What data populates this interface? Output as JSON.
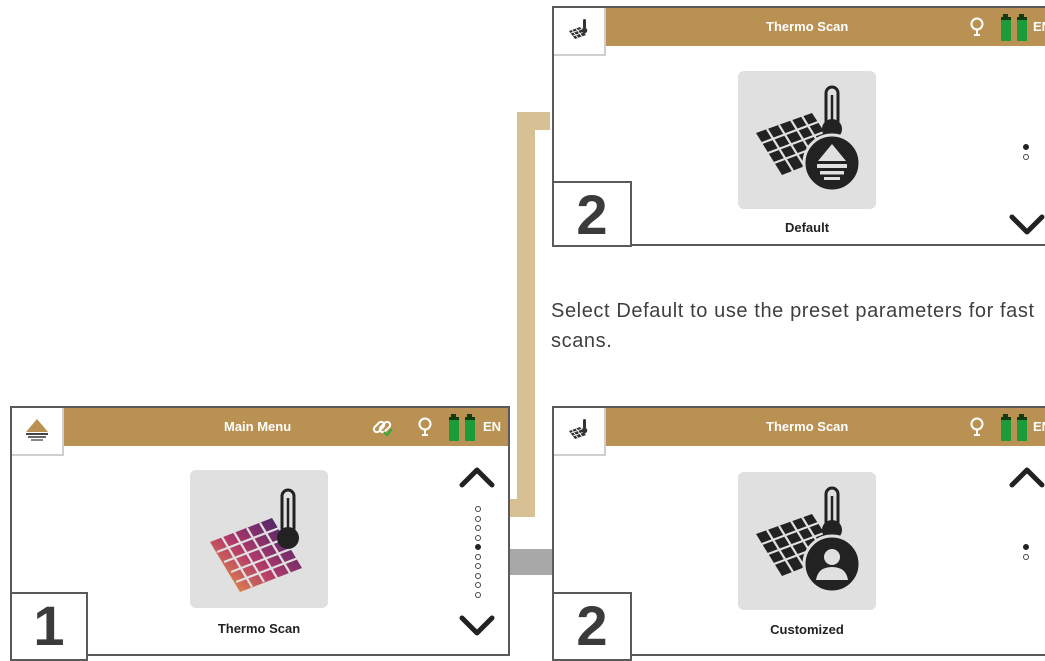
{
  "panel_main": {
    "title": "Main Menu",
    "icons": [
      "pyramid-logo-icon",
      "link-check-icon",
      "lightbulb-icon",
      "battery-icon"
    ],
    "language": "EN",
    "tile_label": "Thermo Scan",
    "tile_icon": "thermo-scan-icon",
    "step_number": "1",
    "pager_total": 10,
    "pager_active_index": 4
  },
  "panel_default": {
    "title": "Thermo Scan",
    "language": "EN",
    "tile_label": "Default",
    "tile_icon": "default-mode-icon",
    "step_number": "2",
    "pager_total": 2,
    "pager_active_index": 0
  },
  "panel_custom": {
    "title": "Thermo Scan",
    "language": "EN",
    "tile_label": "Customized",
    "tile_icon": "customized-mode-icon",
    "step_number": "2",
    "pager_total": 2,
    "pager_active_index": 0
  },
  "instruction": "Select Default to use the preset parameters for fast scans.",
  "colors": {
    "header": "#b99253",
    "connector_tan": "#d8c095",
    "connector_gray": "#a8a8a8",
    "battery_green": "#1d9a3a",
    "battery_dark": "#0f3d12"
  }
}
